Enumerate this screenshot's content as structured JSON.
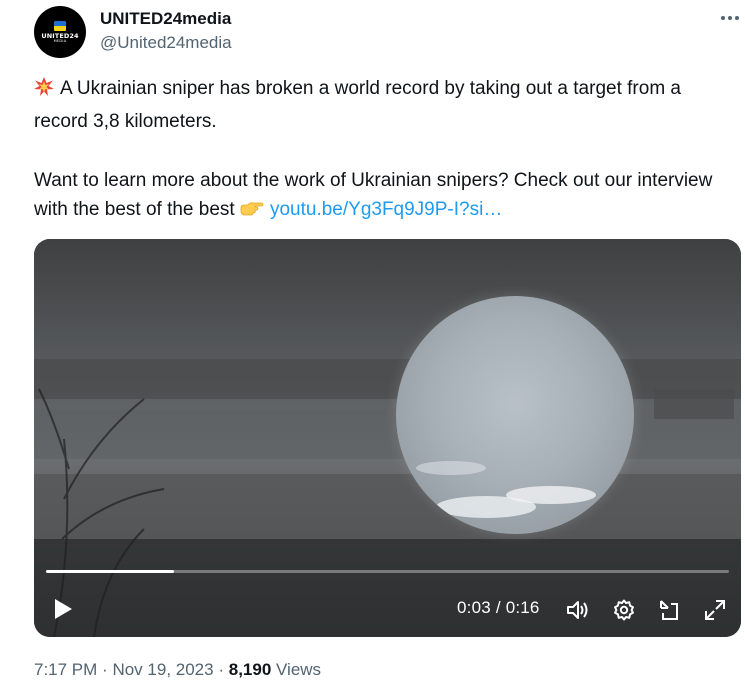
{
  "author": {
    "avatar_brand": "UNITED24",
    "avatar_sub": "MEDIA",
    "display_name": "UNITED24media",
    "handle": "@United24media"
  },
  "tweet": {
    "emoji_icon": "collision-icon",
    "line1": "A Ukrainian sniper has broken a world record by taking out a target from a record 3,8 kilometers.",
    "line2": "Want to learn more about the work of Ukrainian snipers? Check out our interview with the best of the best",
    "pointing_icon": "backhand-index-pointing-right-icon",
    "link": "youtu.be/Yg3Fq9J9P-I?si…"
  },
  "video": {
    "current_time": "0:03",
    "separator": "/",
    "duration": "0:16",
    "progress_fraction": 0.1875,
    "controls": [
      "play-icon",
      "volume-icon",
      "settings-icon",
      "pop-out-icon",
      "fullscreen-icon"
    ]
  },
  "meta": {
    "time": "7:17 PM",
    "dot1": "·",
    "date": "Nov 19, 2023",
    "dot2": "·",
    "views_count": "8,190",
    "views_label": "Views"
  },
  "colors": {
    "link": "#1d9bf0",
    "secondary_text": "#536471",
    "primary_text": "#0f1419"
  }
}
